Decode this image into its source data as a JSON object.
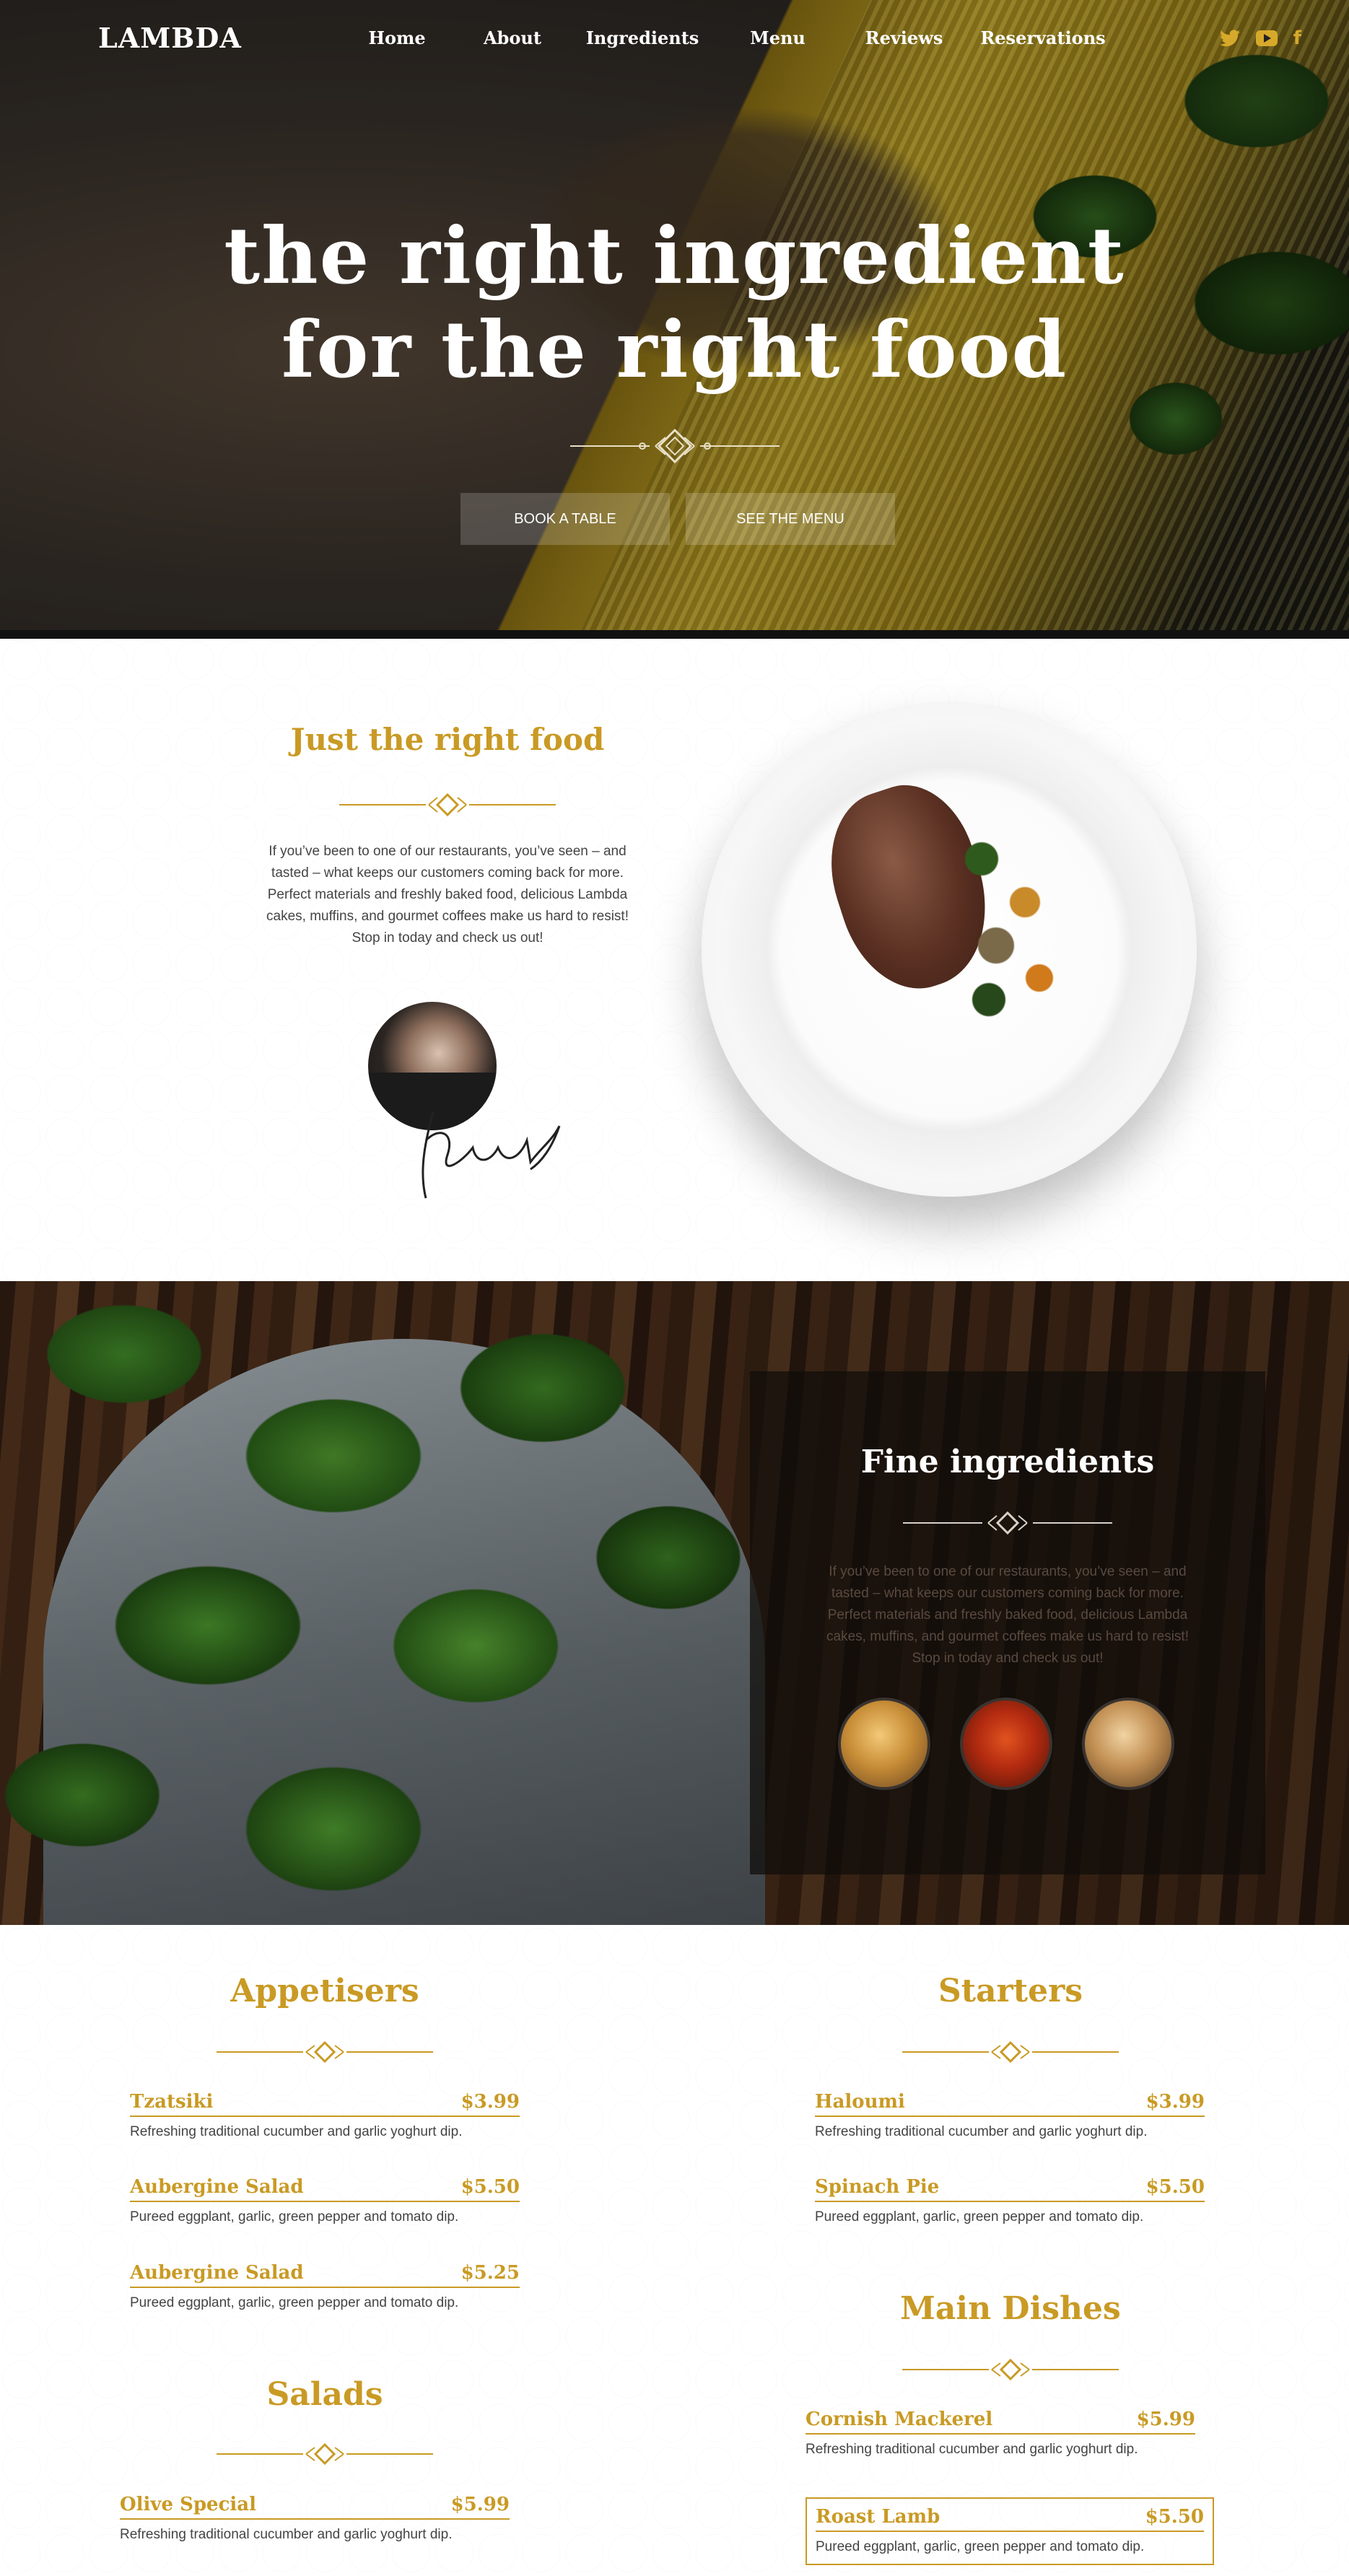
{
  "brand": {
    "logo": "LAMBDA",
    "accent_color": "#c99a24"
  },
  "nav": {
    "items": [
      "Home",
      "About",
      "Ingredients",
      "Menu",
      "Reviews",
      "Reservations"
    ],
    "social_icons": [
      "twitter-icon",
      "youtube-icon",
      "facebook-icon"
    ]
  },
  "hero": {
    "title_line1": "the right ingredient",
    "title_line2": "for the right food",
    "book_button": "BOOK A TABLE",
    "menu_button": "SEE THE MENU"
  },
  "about": {
    "title": "Just the right food",
    "text": "If you’ve been to one of our restaurants, you’ve seen – and tasted – what keeps our customers coming back for more. Perfect materials and freshly baked food, delicious Lambda cakes, muffins, and gourmet coffees make us hard to resist! Stop in today and check us out!"
  },
  "ingredients": {
    "title": "Fine ingredients",
    "text": "If you’ve been to one of our restaurants, you’ve seen – and tasted – what keeps our customers coming back for more. Perfect materials and freshly baked food, delicious Lambda cakes, muffins, and gourmet coffees make us hard to resist! Stop in today and check us out!"
  },
  "menu": {
    "appetisers": {
      "title": "Appetisers",
      "items": [
        {
          "name": "Tzatsiki",
          "price": "$3.99",
          "desc": "Refreshing traditional cucumber and garlic yoghurt dip."
        },
        {
          "name": "Aubergine Salad",
          "price": "$5.50",
          "desc": "Pureed eggplant, garlic, green pepper and tomato dip."
        },
        {
          "name": "Aubergine Salad",
          "price": "$5.25",
          "desc": "Pureed eggplant, garlic, green pepper and tomato dip."
        }
      ]
    },
    "salads": {
      "title": "Salads",
      "items": [
        {
          "name": "Olive Special",
          "price": "$5.99",
          "desc": "Refreshing traditional cucumber and garlic yoghurt dip."
        }
      ]
    },
    "starters": {
      "title": "Starters",
      "items": [
        {
          "name": "Haloumi",
          "price": "$3.99",
          "desc": "Refreshing traditional cucumber and garlic yoghurt dip."
        },
        {
          "name": "Spinach Pie",
          "price": "$5.50",
          "desc": "Pureed eggplant, garlic, green pepper and tomato dip."
        }
      ]
    },
    "main_dishes": {
      "title": "Main Dishes",
      "items": [
        {
          "name": "Cornish Mackerel",
          "price": "$5.99",
          "desc": "Refreshing traditional cucumber and garlic yoghurt dip."
        },
        {
          "name": "Roast Lamb",
          "price": "$5.50",
          "desc": "Pureed eggplant, garlic, green pepper and tomato dip."
        }
      ]
    }
  }
}
